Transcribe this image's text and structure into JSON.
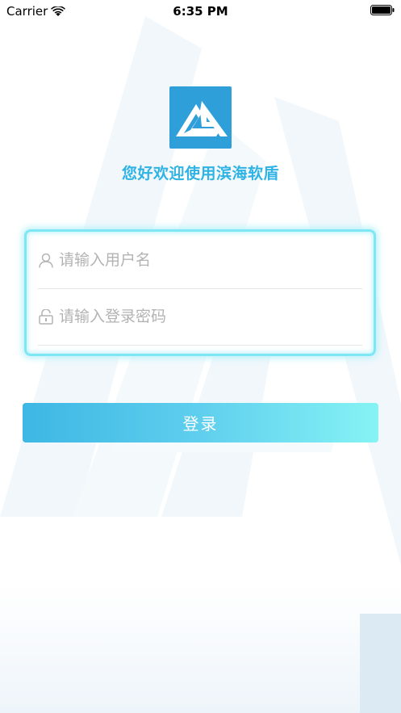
{
  "status_bar": {
    "carrier": "Carrier",
    "time": "6:35 PM",
    "wifi_icon": "wifi-icon",
    "battery_icon": "battery-full-icon"
  },
  "brand": {
    "logo_icon": "logo-icon",
    "welcome_text": "您好欢迎使用滨海软盾",
    "logo_color": "#2e9fd9",
    "welcome_color": "#2fb3e4"
  },
  "login_form": {
    "username": {
      "icon": "user-icon",
      "placeholder": "请输入用户名",
      "value": ""
    },
    "password": {
      "icon": "lock-icon",
      "placeholder": "请输入登录密码",
      "value": ""
    },
    "submit_label": "登录",
    "card_border_color": "#7ee6f5",
    "button_gradient": [
      "#3db7e4",
      "#86f3f4"
    ]
  }
}
